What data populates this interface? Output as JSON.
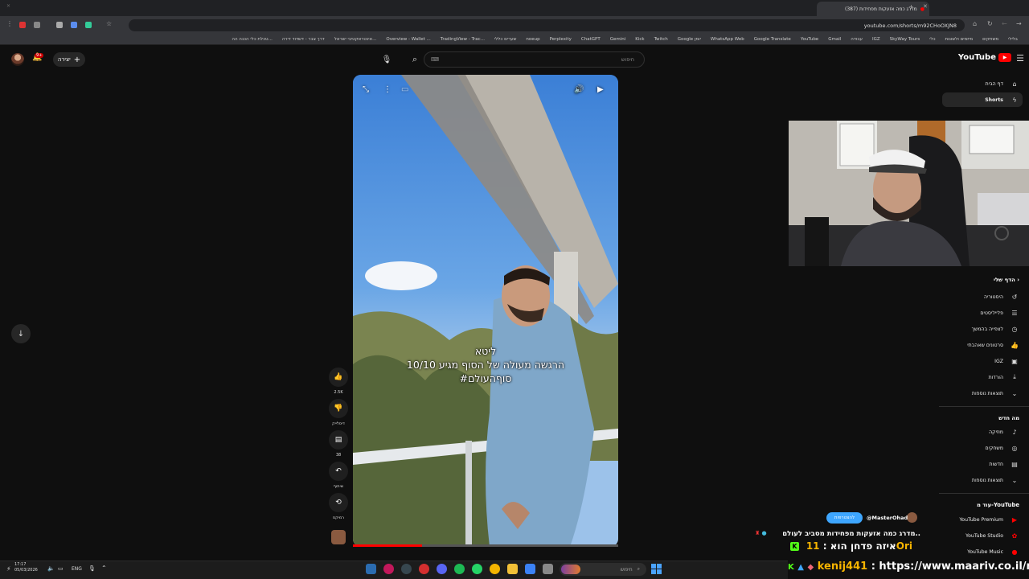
{
  "browser": {
    "active_tab_title": "(387) מדרג כמה אזעקות מפחידות",
    "url": "youtube.com/shorts/m92CHoOXJN8",
    "bookmarks": [
      "בלילי",
      "משחקים",
      "מיזמים ולשונות",
      "כלי",
      "SkyWay Tours",
      "IGZ",
      "עבודה",
      "Gmail",
      "YouTube",
      "Google Translate",
      "WhatsApp Web",
      "Google יומן",
      "Twitch",
      "Kick",
      "Gemini",
      "ChatGPT",
      "Perplexity",
      "noeup",
      "שערים כללי",
      "TradingView - Trac...",
      "Overview - Wallet ...",
      "אינטראקטיבי ישראל...",
      "דרך צבר - דשדוד דירה",
      "טכלת כלי הכנה הה..."
    ]
  },
  "header": {
    "logo_text": "YouTube",
    "search_placeholder": "חיפוש",
    "create_label": "יצירה",
    "notif_count": "9+"
  },
  "sidebar": {
    "main": [
      {
        "label": "דף הבית",
        "icon": "home-icon"
      },
      {
        "label": "Shorts",
        "icon": "shorts-icon"
      }
    ],
    "you_heading": "הדף שלי",
    "you_items": [
      {
        "label": "היסטוריה",
        "icon": "history-icon"
      },
      {
        "label": "פלייליסטים",
        "icon": "playlist-icon"
      },
      {
        "label": "לצפייה בהמשך",
        "icon": "clock-icon"
      },
      {
        "label": "סרטונים שאהבתי",
        "icon": "thumb-up-icon"
      },
      {
        "label": "IGZ",
        "icon": "video-icon"
      },
      {
        "label": "הורדות",
        "icon": "download-icon"
      },
      {
        "label": "תוצאות נוספות",
        "icon": "chevron-down-icon"
      }
    ],
    "new_heading": "מה חדש",
    "new_items": [
      {
        "label": "מוזיקה",
        "icon": "music-icon"
      },
      {
        "label": "משחקים",
        "icon": "gaming-icon"
      },
      {
        "label": "חדשות",
        "icon": "news-icon"
      },
      {
        "label": "תוצאות נוספות",
        "icon": "chevron-down-icon"
      }
    ],
    "more_heading": "עוד מ-YouTube",
    "more_items": [
      {
        "label": "YouTube Premium"
      },
      {
        "label": "YouTube Studio"
      },
      {
        "label": "YouTube Music"
      }
    ]
  },
  "video": {
    "caption_line1": "ליטא",
    "caption_line2": "10/10 הרגשה מעולה של הסוף מגיע",
    "caption_line3": "#סוףהעולם",
    "progress": 0.26
  },
  "actions": {
    "like_count": "2.5K",
    "dislike_label": "דיסלייק",
    "comment_count": "38",
    "share_label": "שיתוף",
    "remix_label": "רמיקס"
  },
  "stream_overlay": {
    "chat_user": "@MasterOhad",
    "chat_pill": "להצטרפות",
    "chat_message": "מדרג כמה אזעקות מפחידות מסביב לעולם..",
    "ticker1_prefix": "איזה פדחן הוא :",
    "ticker1_name": "11Ori",
    "ticker2_name": "kenij441",
    "ticker2_text": ": https://www.maariv.co.il/news"
  },
  "taskbar": {
    "time": "17:17",
    "date": "05/03/2026",
    "lang": "ENG",
    "search_label": "חיפוש"
  },
  "colors": {
    "yt_red": "#ff0000",
    "accent_blue": "#3ea6ff",
    "ticker_yellow": "#f6b400"
  }
}
